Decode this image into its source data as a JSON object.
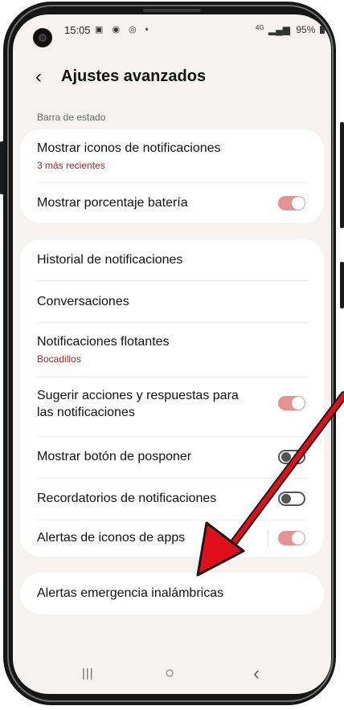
{
  "status": {
    "time": "15:05",
    "icons": "▣ ◉ ◎ •",
    "network": "4G",
    "signal": "▂▄▆",
    "battery_pct": "95%"
  },
  "header": {
    "back": "‹",
    "title": "Ajustes avanzados"
  },
  "section": {
    "label": "Barra de estado"
  },
  "card1": {
    "row1": {
      "title": "Mostrar iconos de notificaciones",
      "sub": "3 más recientes"
    },
    "row2": {
      "title": "Mostrar porcentaje batería",
      "toggle": true
    }
  },
  "card2": {
    "row1": {
      "title": "Historial de notificaciones"
    },
    "row2": {
      "title": "Conversaciones"
    },
    "row3": {
      "title": "Notificaciones flotantes",
      "sub": "Bocadillos"
    },
    "row4": {
      "title_l1": "Sugerir acciones y respuestas para",
      "title_l2": "las notificaciones",
      "toggle": true
    },
    "row5": {
      "title": "Mostrar botón de posponer",
      "toggle": false
    },
    "row6": {
      "title": "Recordatorios de notificaciones",
      "toggle": false
    },
    "row7": {
      "title": "Alertas de iconos de apps",
      "toggle": true
    }
  },
  "card3": {
    "row1": {
      "title": "Alertas emergencia inalámbricas"
    }
  },
  "navbar": {
    "recents": "|||",
    "home": "○",
    "back": "‹"
  },
  "colors": {
    "accent_sub": "#a0282a",
    "toggle_on": "#e79292",
    "annotation_arrow": "#e0101a",
    "screen_bg": "#f6f2f2"
  }
}
